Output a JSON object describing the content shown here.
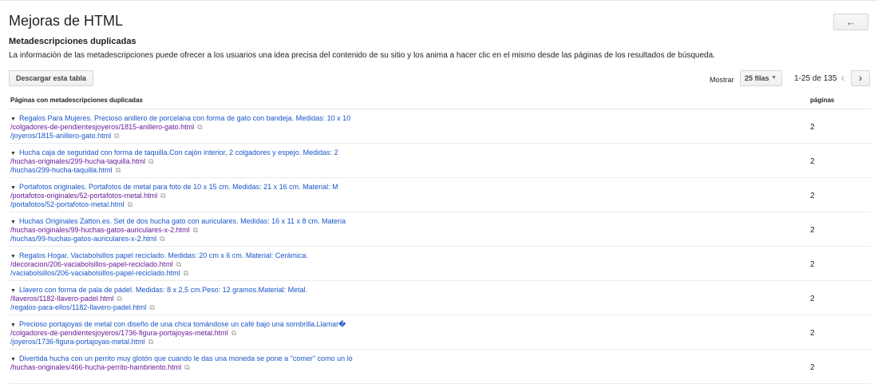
{
  "header": {
    "title": "Mejoras de HTML",
    "back_icon": "←"
  },
  "section": {
    "subtitle": "Metadescripciones duplicadas",
    "description": "La información de las metadescripciones puede ofrecer a los usuarios una idea precisa del contenido de su sitio y los anima a hacer clic en el mismo desde las páginas de los resultados de búsqueda."
  },
  "toolbar": {
    "download_label": "Descargar esta tabla",
    "show_label": "Mostrar",
    "rows_value": "25 filas",
    "caret": "▼",
    "range": "1-25 de 135",
    "prev": "‹",
    "next": "›"
  },
  "table": {
    "col_url": "Páginas con metadescripciones duplicadas",
    "col_pages": "páginas",
    "triangle": "▼",
    "ext_icon": "⧉",
    "rows": [
      {
        "title": "Regalos Para Mujeres. Precioso anillero de porcelana con forma de gato con bandeja. Medidas: 10 x 10",
        "url1": "/colgadores-de-pendientesjoyeros/1815-anillero-gato.html",
        "url2": "/joyeros/1815-anillero-gato.html",
        "pages": "2"
      },
      {
        "title": "Hucha caja de seguridad con forma de taquilla.Con cajón interior, 2 colgadores y espejo. Medidas: 2",
        "url1": "/huchas-originales/299-hucha-taquilla.html",
        "url2": "/huchas/299-hucha-taquilla.html",
        "pages": "2"
      },
      {
        "title": "Portafotos originales. Portafotos de metal para foto de 10 x 15 cm. Medidas: 21 x 16 cm. Material: M",
        "url1": "/portafotos-originales/52-portafotos-metal.html",
        "url2": "/portafotos/52-portafotos-metal.html",
        "pages": "2"
      },
      {
        "title": "Huchas Originales Zatton.es. Set de dos hucha gato con auriculares. Medidas: 16 x 11 x 8 cm. Materia",
        "url1": "/huchas-originales/99-huchas-gatos-auriculares-x-2.html",
        "url2": "/huchas/99-huchas-gatos-auriculares-x-2.html",
        "pages": "2"
      },
      {
        "title": "Regalos Hogar. Vaciabolsillos papel reciclado. Medidas: 20 cm x 6 cm. Material: Cerámica.",
        "url1": "/decoracion/206-vaciabolsillos-papel-reciclado.html",
        "url2": "/vaciabolsillos/206-vaciabolsillos-papel-reciclado.html",
        "pages": "2"
      },
      {
        "title": "Llavero con forma de pala de pádel. Medidas: 8 x 2,5 cm.Peso: 12 gramos.Material: Metal.",
        "url1": "/llaveros/1182-llavero-padel.html",
        "url2": "/regalos-para-ellos/1182-llavero-padel.html",
        "pages": "2"
      },
      {
        "title": "Precioso portajoyas de metal con diseño de una chica tomándose un café bajo una sombrilla.Llamar�",
        "url1": "/colgadores-de-pendientesjoyeros/1736-figura-portajoyas-metal.html",
        "url2": "/joyeros/1736-figura-portajoyas-metal.html",
        "pages": "2"
      },
      {
        "title": "Divertida hucha con un perrito muy glotón que cuando le das una moneda se pone a \"comer\" como un lo",
        "url1": "/huchas-originales/466-hucha-perrito-hambriento.html",
        "url2": "",
        "pages": "2"
      }
    ]
  }
}
